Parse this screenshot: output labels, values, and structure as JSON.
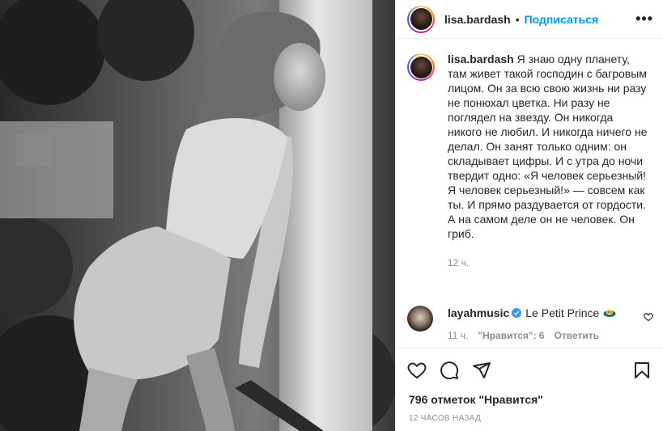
{
  "post": {
    "username": "lisa.bardash",
    "separator": "•",
    "follow_label": "Подписаться",
    "more_label": "•••",
    "caption_user": "lisa.bardash",
    "caption_text": "Я знаю одну планету, там живет такой господин с багровым лицом. Он за всю свою жизнь ни разу не понюхал цветка. Ни разу не поглядел на звезду. Он никогда никого не любил. И никогда ничего не делал. Он занят только одним: он складывает цифры. И с утра до ночи твердит одно: «Я человек серьезный! Я человек серьезный!» — совсем как ты. И прямо раздувается от гордости. А на самом деле он не человек. Он гриб.",
    "caption_time": "12 ч.",
    "likes": "796 отметок \"Нравится\"",
    "posted": "12 ЧАСОВ НАЗАД"
  },
  "comment": {
    "username": "layahmusic",
    "text": "Le Petit Prince",
    "time": "11 ч.",
    "likes": "\"Нравится\": 6",
    "reply": "Ответить"
  },
  "icons": {
    "like": "heart-icon",
    "comment": "comment-icon",
    "share": "send-icon",
    "save": "bookmark-icon",
    "verified": "verified-badge-icon",
    "comment_like": "heart-icon"
  },
  "colors": {
    "accent": "#0095f6",
    "muted": "#8e8e8e",
    "text": "#262626",
    "border": "#efefef"
  }
}
